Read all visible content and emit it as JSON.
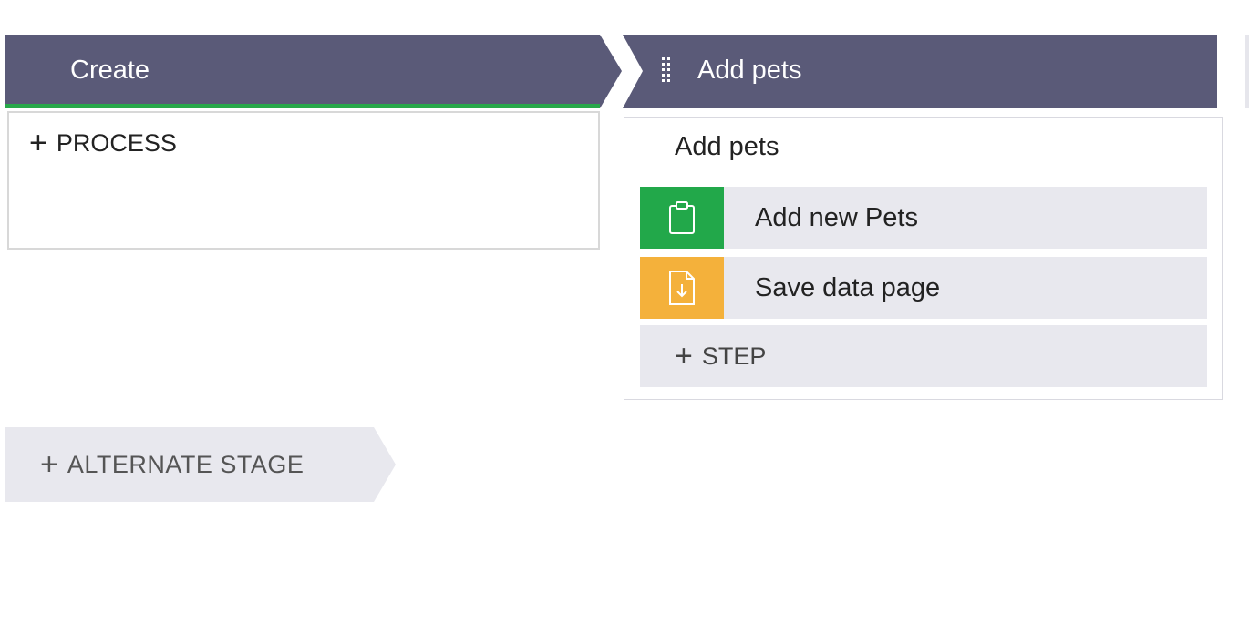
{
  "stages": {
    "create": {
      "label": "Create"
    },
    "add_pets": {
      "label": "Add pets"
    }
  },
  "create_panel": {
    "add_process_label": "PROCESS"
  },
  "add_pets_panel": {
    "process_title": "Add pets",
    "steps": [
      {
        "label": "Add new Pets",
        "icon": "clipboard-icon",
        "color": "#22a84a"
      },
      {
        "label": "Save data page",
        "icon": "save-data-icon",
        "color": "#f4b13b"
      }
    ],
    "add_step_label": "STEP"
  },
  "alternate_stage": {
    "label": "ALTERNATE STAGE"
  },
  "colors": {
    "stage_bg": "#5a5a78",
    "active_underline": "#28a84a",
    "step_bg": "#e8e8ee"
  }
}
